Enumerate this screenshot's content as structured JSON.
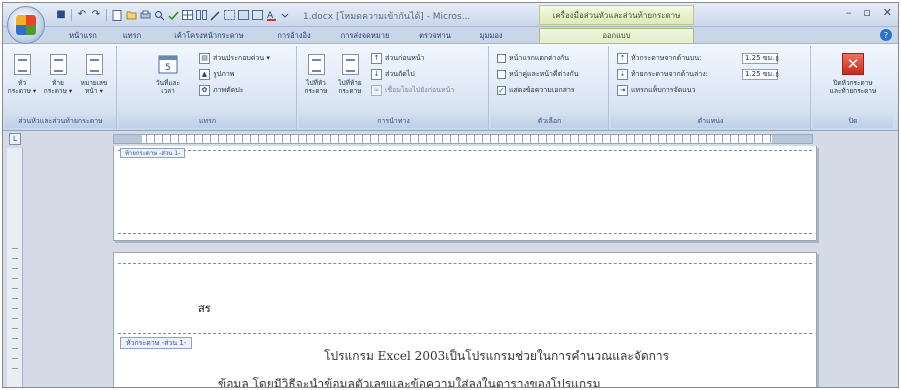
{
  "app": {
    "doc_title": "1.docx [โหมดความเข้ากันได้] - Micros...",
    "context_tab_title": "เครื่องมือส่วนหัวและส่วนท้ายกระดาษ",
    "window_controls": {
      "minimize": "–",
      "restore": "▫",
      "close": "✕"
    }
  },
  "quick_access": {
    "undo": "↶",
    "redo": "↷",
    "save": "■"
  },
  "tabs": [
    {
      "label": "หน้าแรก"
    },
    {
      "label": "แทรก"
    },
    {
      "label": "เค้าโครงหน้ากระดาษ"
    },
    {
      "label": "การอ้างอิง"
    },
    {
      "label": "การส่งจดหมาย"
    },
    {
      "label": "ตรวจทาน"
    },
    {
      "label": "มุมมอง"
    },
    {
      "label": "ออกแบบ",
      "active": true
    }
  ],
  "ribbon": {
    "hf_group": {
      "label": "ส่วนหัวและส่วนท้ายกระดาษ",
      "buttons": [
        {
          "label": "หัว\nกระดาษ ▾"
        },
        {
          "label": "ท้าย\nกระดาษ ▾"
        },
        {
          "label": "หมายเลข\nหน้า ▾"
        }
      ]
    },
    "insert_group": {
      "label": "แทรก",
      "big_label": "วันที่และ\nเวลา",
      "items": [
        {
          "label": "ส่วนประกอบด่วน ▾"
        },
        {
          "label": "รูปภาพ"
        },
        {
          "label": "ภาพตัดปะ"
        }
      ]
    },
    "nav_group": {
      "label": "การนำทาง",
      "buttons": [
        {
          "label": "ไปที่หัว\nกระดาษ"
        },
        {
          "label": "ไปที่ท้าย\nกระดาษ"
        }
      ],
      "items": [
        {
          "label": "ส่วนก่อนหน้า"
        },
        {
          "label": "ส่วนถัดไป"
        },
        {
          "label": "เชื่อมโยงไปยังก่อนหน้า"
        }
      ]
    },
    "options_group": {
      "label": "ตัวเลือก",
      "checks": [
        {
          "label": "หน้าแรกแตกต่างกัน",
          "checked": false
        },
        {
          "label": "หน้าคู่และหน้าคี่ต่างกัน",
          "checked": false
        },
        {
          "label": "แสดงข้อความเอกสาร",
          "checked": true
        }
      ]
    },
    "position_group": {
      "label": "ตำแหน่ง",
      "items": [
        {
          "label": "หัวกระดาษจากด้านบน:",
          "value": "1.25 ซม."
        },
        {
          "label": "ท้ายกระดาษจากด้านล่าง:",
          "value": "1.25 ซม."
        },
        {
          "label": "แทรกแท็บการจัดแนว"
        }
      ]
    },
    "close_group": {
      "label": "ปิด",
      "button": "ปิดหัวกระดาษ\nและท้ายกระดาษ"
    }
  },
  "document": {
    "footer_tag_page1": "ท้ายกระดาษ -ส่วน 1-",
    "header_text": "สร",
    "header_tag_page2": "หัวกระดาษ -ส่วน 1-",
    "body_line_1": "โปรแกรม Excel 2003เป็นโปรแกรมช่วยในการคำนวณและจัดการ",
    "body_line_2": "ข้อมูล โดยมีวิธีจะนำข้อมูลตัวเลขและข้อความใส่ลงในตารางของโปรแกรม"
  }
}
